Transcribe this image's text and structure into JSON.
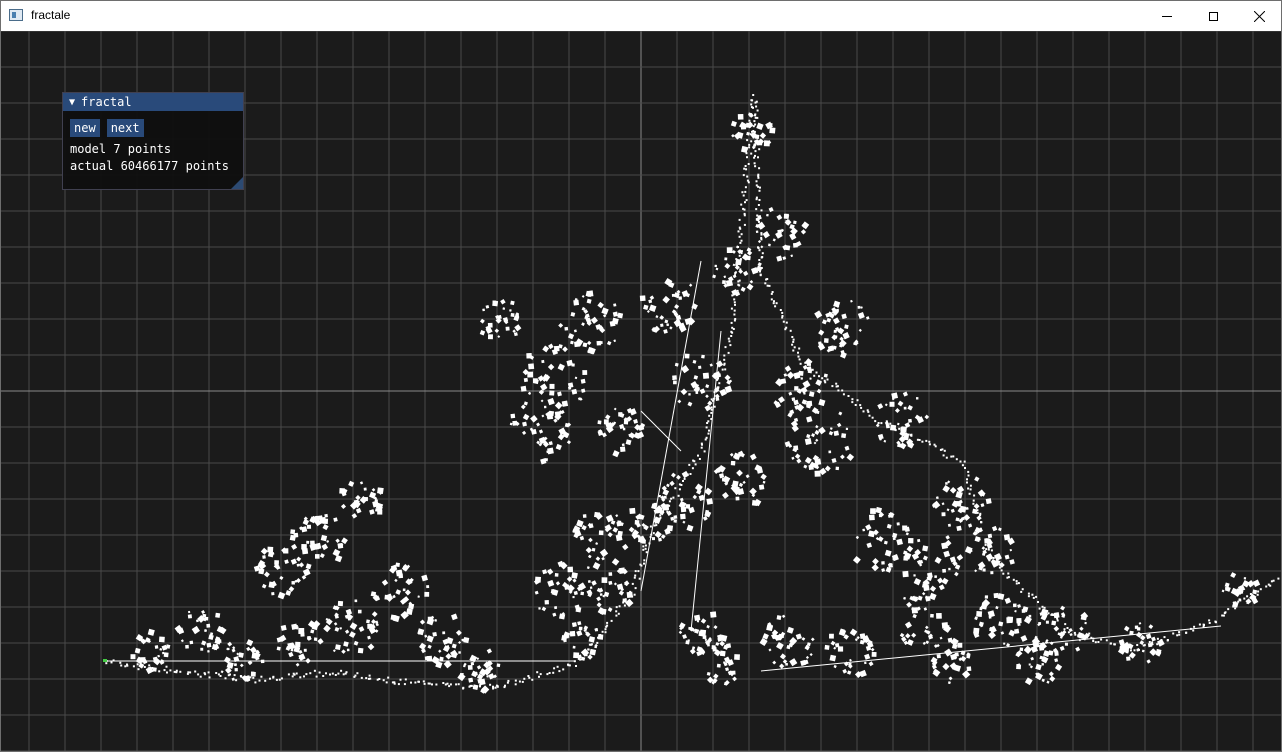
{
  "window": {
    "title": "fractale",
    "controls": {
      "minimize": "minimize-icon",
      "maximize": "maximize-icon",
      "close": "close-icon"
    }
  },
  "panel": {
    "title": "fractal",
    "collapse_icon": "▼",
    "buttons": {
      "new_label": "new",
      "next_label": "next"
    },
    "model_text": "model 7 points",
    "actual_text": "actual 60466177 points"
  },
  "colors": {
    "background": "#1b1b1b",
    "grid": "#4a4a4a",
    "axis": "#8a8a8a",
    "fractal": "#ffffff",
    "accent": "#294a7a",
    "start_point": "#44cc44"
  }
}
